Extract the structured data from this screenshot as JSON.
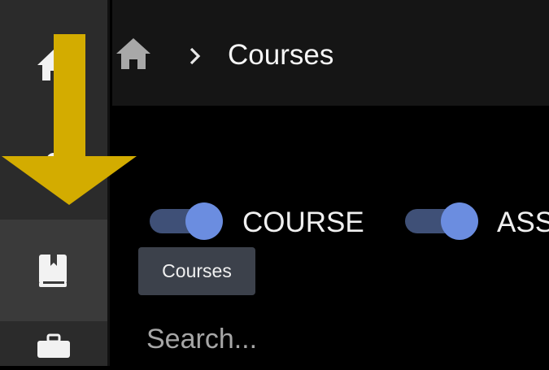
{
  "breadcrumb": {
    "home_icon": "home-icon",
    "separator_icon": "chevron-right-icon",
    "current": "Courses"
  },
  "sidebar": {
    "items": [
      {
        "icon": "home-icon"
      },
      {
        "icon": "profile-icon"
      },
      {
        "icon": "book-icon",
        "active": true
      },
      {
        "icon": "briefcase-icon"
      }
    ]
  },
  "toggles": [
    {
      "label": "COURSE",
      "on": true
    },
    {
      "label": "ASS",
      "on": true
    }
  ],
  "tooltip": {
    "text": "Courses"
  },
  "search": {
    "placeholder": "Search..."
  },
  "annotation": {
    "icon": "down-arrow-icon",
    "color": "#d3ac00"
  },
  "colors": {
    "toggle_track": "#3f5077",
    "toggle_knob": "#6b8de0",
    "sidebar_bg": "#2b2b2b",
    "sidebar_active": "#3a3a3a"
  }
}
